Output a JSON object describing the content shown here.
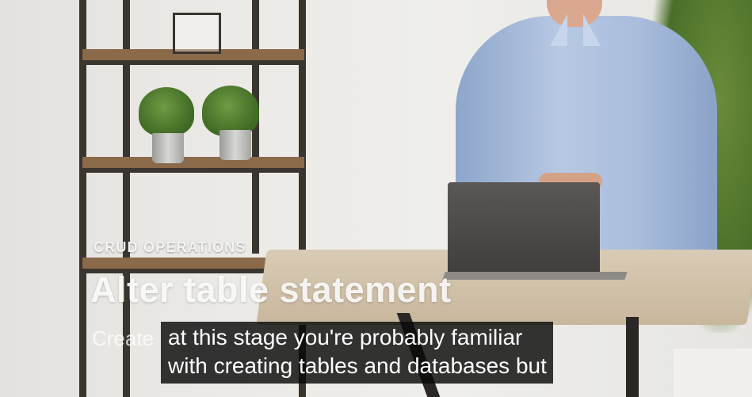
{
  "video": {
    "kicker": "CRUD OPERATIONS",
    "title": "Alter table statement",
    "subtitle_partial": "Create"
  },
  "captions": {
    "line1": "at this stage you're probably familiar",
    "line2": "with creating tables and databases but"
  },
  "colors": {
    "caption_background": "#080808",
    "caption_text": "#ffffff",
    "shirt": "#a9bddc",
    "desk": "#d2c2aa"
  }
}
